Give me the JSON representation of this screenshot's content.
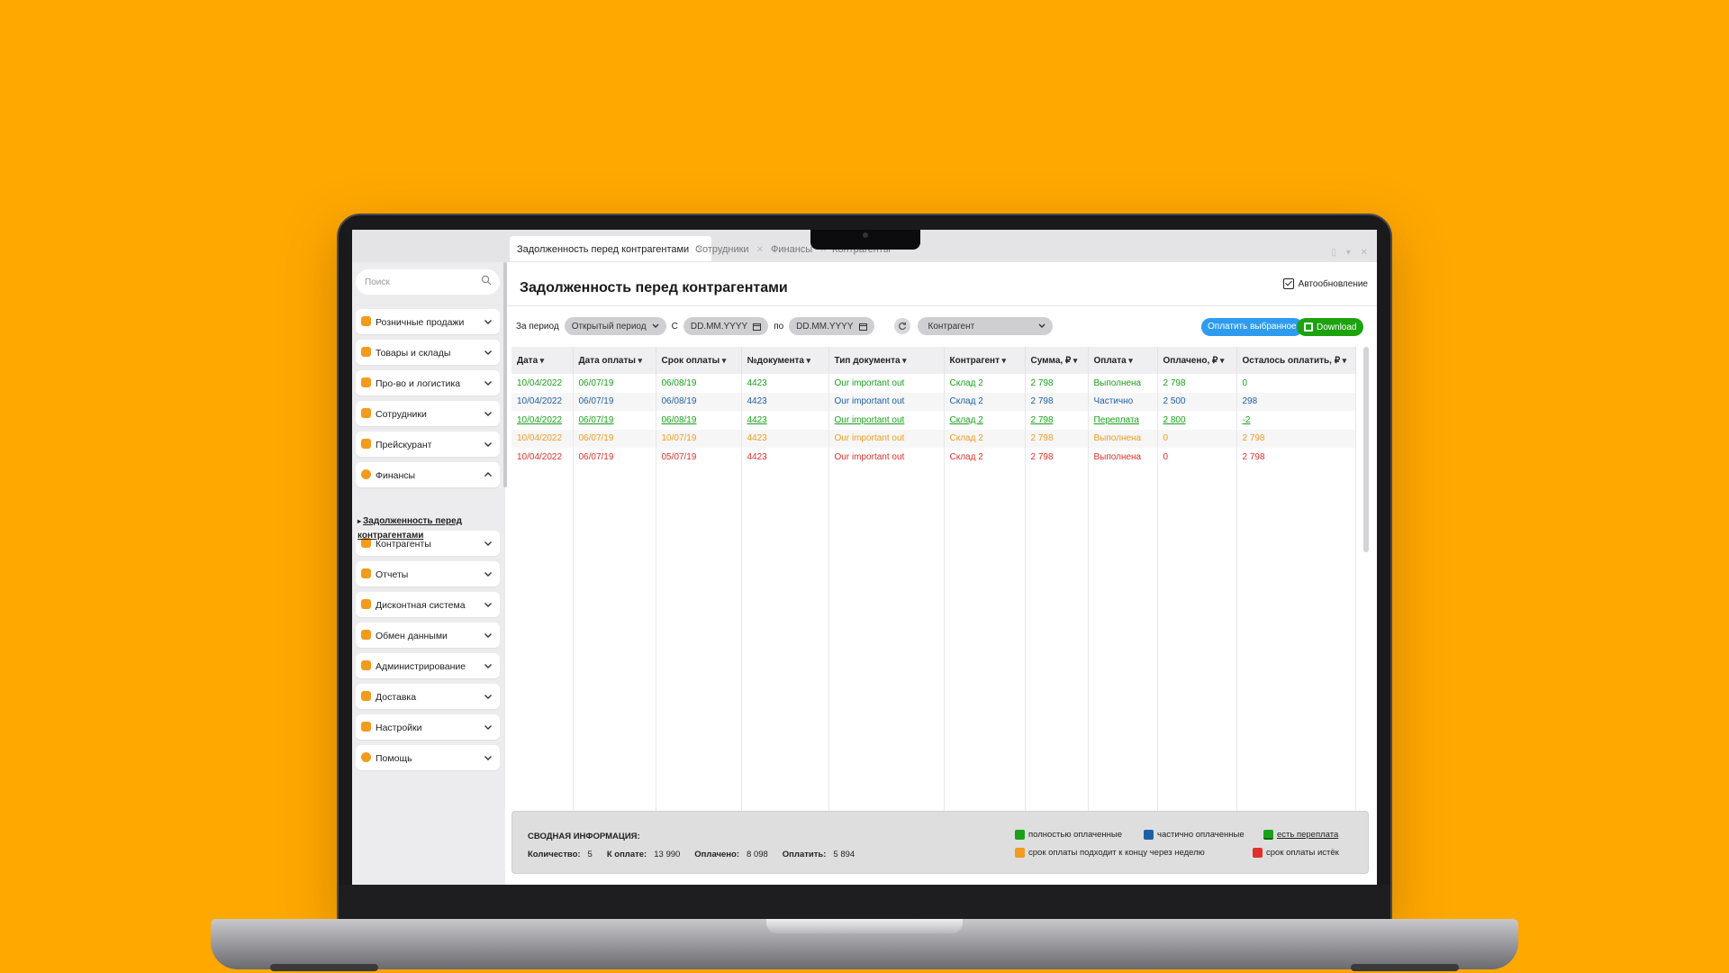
{
  "colors": {
    "background": "#FFA800",
    "accent_blue": "#2E9BEF",
    "accent_green": "#1CA30E",
    "status_paid": "#19A11B",
    "status_partial": "#1F5FA8",
    "status_due_soon": "#F29B1D",
    "status_overdue": "#E0302B"
  },
  "tabs": [
    {
      "label": "Задолженность перед контрагентами",
      "active": true
    },
    {
      "label": "Сотрудники",
      "active": false
    },
    {
      "label": "Финансы",
      "active": false
    },
    {
      "label": "Контрагенты",
      "active": false
    }
  ],
  "sidebar": {
    "search_placeholder": "Поиск",
    "items": [
      {
        "label": "Розничные продажи",
        "icon": "retail-icon"
      },
      {
        "label": "Товары и склады",
        "icon": "goods-icon"
      },
      {
        "label": "Про-во и логистика",
        "icon": "logistics-icon"
      },
      {
        "label": "Сотрудники",
        "icon": "employees-icon"
      },
      {
        "label": "Прейскурант",
        "icon": "pricelist-icon"
      },
      {
        "label": "Финансы",
        "icon": "finance-icon",
        "expanded": true
      },
      {
        "label": "Контрагенты",
        "icon": "contractors-icon"
      },
      {
        "label": "Отчеты",
        "icon": "reports-icon"
      },
      {
        "label": "Дисконтная система",
        "icon": "discount-icon"
      },
      {
        "label": "Обмен данными",
        "icon": "exchange-icon"
      },
      {
        "label": "Администрирование",
        "icon": "admin-icon"
      },
      {
        "label": "Доставка",
        "icon": "delivery-icon"
      },
      {
        "label": "Настройки",
        "icon": "settings-icon"
      },
      {
        "label": "Помощь",
        "icon": "help-icon"
      }
    ],
    "sub_item": "Задолженность перед контрагентами"
  },
  "page": {
    "title": "Задолженность перед контрагентами",
    "autoupdate_label": "Автообновление",
    "autoupdate_checked": true
  },
  "filters": {
    "period_label": "За период",
    "period_value": "Открытый период",
    "from_label": "С",
    "from_placeholder": "DD.MM.YYYY",
    "to_label": "по",
    "to_placeholder": "DD.MM.YYYY",
    "contractor_value": "Контрагент",
    "pay_selected_label": "Оплатить выбранное",
    "download_label": "Download"
  },
  "table": {
    "columns": [
      "Дата",
      "Дата оплаты",
      "Срок оплаты",
      "№документа",
      "Тип документа",
      "Контрагент",
      "Сумма, ₽",
      "Оплата",
      "Оплачено, ₽",
      "Осталось оплатить, ₽"
    ],
    "rows": [
      {
        "status": "green",
        "cells": [
          "10/04/2022",
          "06/07/19",
          "06/08/19",
          "4423",
          "Our important out",
          "Склад 2",
          "2 798",
          "Выполнена",
          "2 798",
          "0"
        ]
      },
      {
        "status": "blue",
        "cells": [
          "10/04/2022",
          "06/07/19",
          "06/08/19",
          "4423",
          "Our important out",
          "Склад 2",
          "2 798",
          "Частично",
          "2 500",
          "298"
        ]
      },
      {
        "status": "over",
        "cells": [
          "10/04/2022",
          "06/07/19",
          "06/08/19",
          "4423",
          "Our important out",
          "Склад 2",
          "2 798",
          "Переплата",
          "2 800",
          "-2"
        ]
      },
      {
        "status": "orange",
        "cells": [
          "10/04/2022",
          "06/07/19",
          "10/07/19",
          "4423",
          "Our important out",
          "Склад 2",
          "2 798",
          "Выполнена",
          "0",
          "2 798"
        ]
      },
      {
        "status": "red",
        "cells": [
          "10/04/2022",
          "06/07/19",
          "05/07/19",
          "4423",
          "Our important out",
          "Склад 2",
          "2 798",
          "Выполнена",
          "0",
          "2 798"
        ]
      }
    ]
  },
  "summary": {
    "title": "СВОДНАЯ ИНФОРМАЦИЯ:",
    "count_label": "Количество:",
    "count_value": "5",
    "topay_label": "К оплате:",
    "topay_value": "13 990",
    "paid_label": "Оплачено:",
    "paid_value": "8 098",
    "remaining_label": "Оплатить:",
    "remaining_value": "5 894",
    "legend": [
      {
        "label": "полностью оплаченные",
        "color": "#19A11B"
      },
      {
        "label": "частично оплаченные",
        "color": "#1F5FA8"
      },
      {
        "label": "есть переплата",
        "color": "#19A11B"
      },
      {
        "label": "срок оплаты подходит к концу через неделю",
        "color": "#F29B1D"
      },
      {
        "label": "срок оплаты истёк",
        "color": "#E0302B"
      }
    ]
  }
}
